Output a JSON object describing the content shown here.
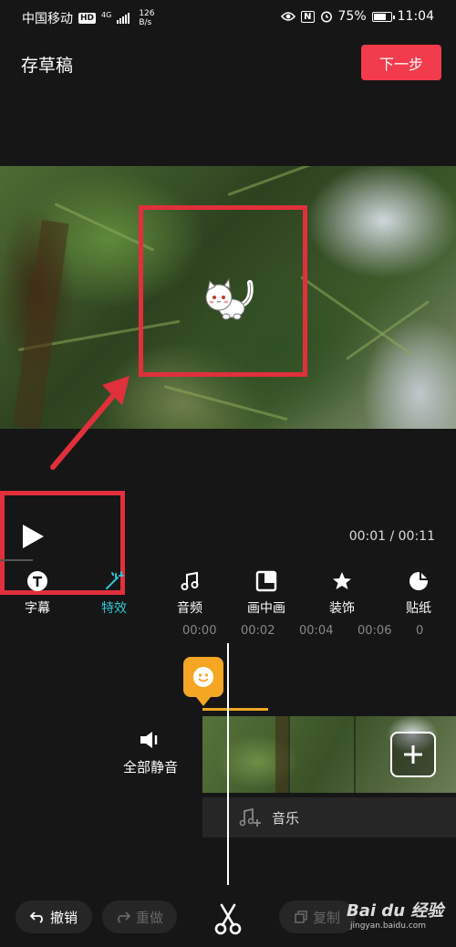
{
  "status_bar": {
    "carrier": "中国移动",
    "hd_badge": "HD",
    "network": "4G",
    "speed_value": "126",
    "speed_unit": "B/s",
    "nfc": "N",
    "battery": "75%",
    "battery_level": 0.75,
    "time": "11:04"
  },
  "header": {
    "draft_label": "存草稿",
    "next_label": "下一步"
  },
  "player": {
    "time_display": "00:01 / 00:11"
  },
  "toolbar": {
    "items": [
      {
        "label": "字幕",
        "icon": "text-icon"
      },
      {
        "label": "特效",
        "icon": "effects-icon",
        "active": true
      },
      {
        "label": "音频",
        "icon": "music-note-icon"
      },
      {
        "label": "画中画",
        "icon": "picture-in-picture-icon"
      },
      {
        "label": "装饰",
        "icon": "star-decor-icon"
      },
      {
        "label": "贴纸",
        "icon": "sticker-icon"
      }
    ]
  },
  "timeline": {
    "ruler": [
      "00:00",
      "00:02",
      "00:04",
      "00:06",
      "0"
    ],
    "mute_label": "全部静音",
    "music_label": "音乐"
  },
  "bottom_bar": {
    "undo_label": "撤销",
    "redo_label": "重做",
    "copy_label": "复制"
  },
  "watermark": {
    "main": "Bai du 经验",
    "sub": "jingyan.baidu.com"
  },
  "colors": {
    "accent_red": "#f23b4c",
    "highlight_red": "#e0303c",
    "active_tab": "#2fc6d6",
    "sticker_orange": "#f5a623"
  }
}
